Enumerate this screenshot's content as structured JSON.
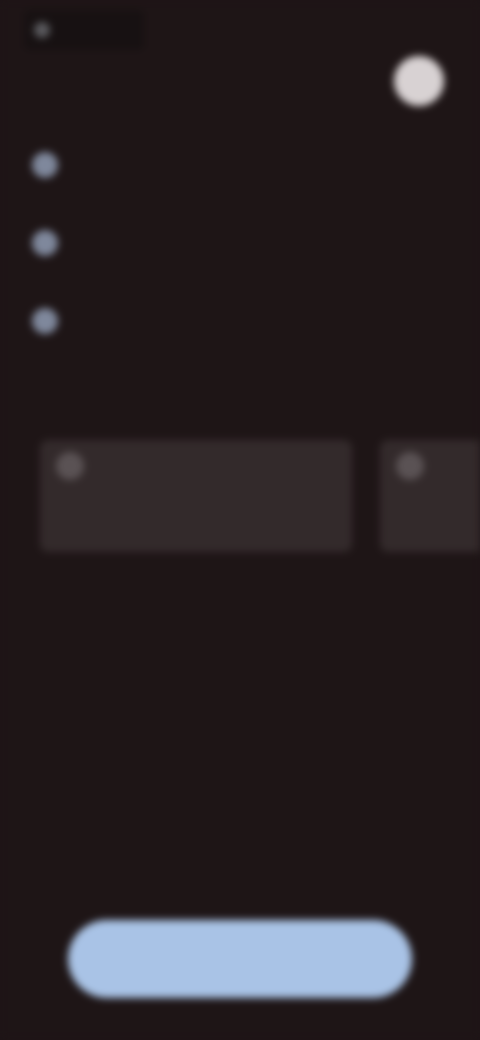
{
  "top_bar": {
    "label": ""
  },
  "page": {
    "title": ""
  },
  "steps": [
    {
      "text": ""
    },
    {
      "text": ""
    },
    {
      "text": ""
    }
  ],
  "note": {
    "text": ""
  },
  "cards": [
    {
      "text": "",
      "icon": "card-icon"
    },
    {
      "text": "",
      "icon": "card-icon"
    }
  ],
  "primary_button": {
    "label": ""
  },
  "colors": {
    "background": "#1e1516",
    "step_icon": "#7f889c",
    "card": "#332a2b",
    "button": "#a9c3e6"
  }
}
